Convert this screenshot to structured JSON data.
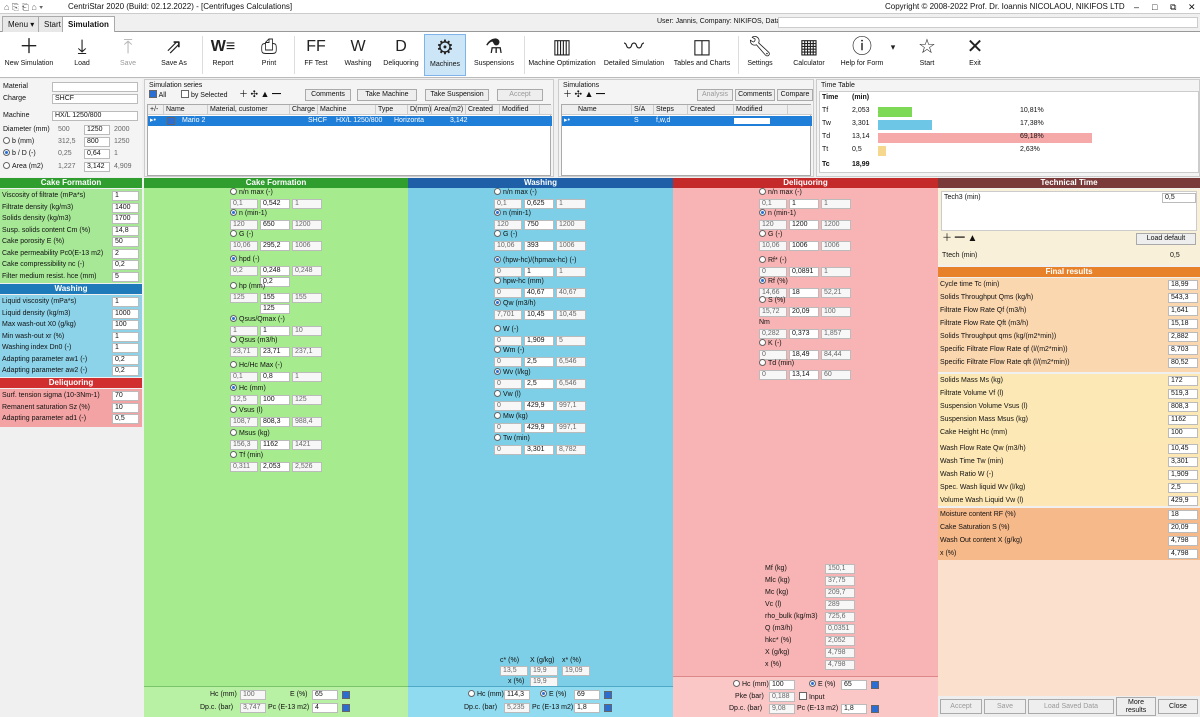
{
  "titlebar": {
    "app": "CentriStar 2020 (Build: 02.12.2022) - [Centrifuges Calculations]",
    "copyright": "Copyright © 2008-2022 Prof. Dr. Ioannis NICOLAOU, NIKIFOS LTD",
    "user": "User: Jannis, Company: NIKIFOS, Database:"
  },
  "tabs": {
    "menu": "Menu",
    "start": "Start",
    "simulation": "Simulation"
  },
  "ribbon": {
    "new": "New Simulation",
    "load": "Load",
    "save": "Save",
    "saveas": "Save As",
    "report": "Report",
    "print": "Print",
    "fftest": "FF Test",
    "washing": "Washing",
    "deliquoring": "Deliquoring",
    "machines": "Machines",
    "suspensions": "Suspensions",
    "machopt": "Machine Optimization",
    "detailed": "Detailed Simulation",
    "tables": "Tables and Charts",
    "settings": "Settings",
    "calculator": "Calculator",
    "help": "Help for Form",
    "start": "Start",
    "exit": "Exit",
    "ff_ico": "FF",
    "w_ico": "W",
    "d_ico": "D"
  },
  "left": {
    "material_lbl": "Material",
    "material": "",
    "charge_lbl": "Charge",
    "charge": "SHCF",
    "machine_lbl": "Machine",
    "machine": "HX/L 1250/800",
    "diam_lbl": "Diameter (mm)",
    "diam": [
      "500",
      "1250",
      "2000"
    ],
    "b_lbl": "b    (mm)",
    "b": [
      "312,5",
      "800",
      "1250"
    ],
    "bd_lbl": "b / D (-)",
    "bd": [
      "0,25",
      "0,64",
      "1"
    ],
    "area_lbl": "Area (m2)",
    "area": [
      "1,227",
      "3,142",
      "4,909"
    ],
    "cake_hdr": "Cake Formation",
    "cake": [
      [
        "Viscosity of filtrate (mPa*s)",
        "1"
      ],
      [
        "Filtrate density (kg/m3)",
        "1400"
      ],
      [
        "Solids density (kg/m3)",
        "1700"
      ],
      [
        "Susp. solids content Cm (%)",
        "14,8"
      ],
      [
        "Cake porosity E (%)",
        "50"
      ],
      [
        "Cake permeability  Pc0(E-13 m2)",
        "2"
      ],
      [
        "Cake compressibility nc (-)",
        "0,2"
      ],
      [
        "Filter medium resist. hce (mm)",
        "5"
      ]
    ],
    "wash_hdr": "Washing",
    "wash": [
      [
        "Liquid viscosity (mPa*s)",
        "1"
      ],
      [
        "Liquid density (kg/m3)",
        "1000"
      ],
      [
        "Max wash-out X0 (g/kg)",
        "100"
      ],
      [
        "Min wash-out xr (%)",
        "1"
      ],
      [
        "Washing index Dn0 (-)",
        "1"
      ],
      [
        "Adapting parameter aw1 (-)",
        "0,2"
      ],
      [
        "Adapting parameter aw2 (-)",
        "0,2"
      ]
    ],
    "deliq_hdr": "Deliquoring",
    "deliq": [
      [
        "Surf. tension sigma (10-3Nm-1)",
        "70"
      ],
      [
        "Remanent saturation Sz (%)",
        "10"
      ],
      [
        "Adapting parameter ad1 (-)",
        "0,5"
      ]
    ]
  },
  "series": {
    "title": "Simulation series",
    "all": "All",
    "bysel": "by Selected",
    "comments": "Comments",
    "takemachine": "Take Machine",
    "takesusp": "Take Suspension",
    "accept": "Accept",
    "cols": [
      "+/-",
      "Name",
      "Material, customer",
      "Charge",
      "Machine",
      "Type",
      "D(mm)",
      "Area(m2)",
      "Created",
      "Modified"
    ],
    "row": [
      "Mario 2",
      "",
      "SHCF",
      "HX/L 1250/800",
      "Horizonta",
      "",
      "3,142",
      "",
      ""
    ]
  },
  "sims": {
    "title": "Simulations",
    "analysis": "Analysis",
    "comments": "Comments",
    "compare": "Compare",
    "cols": [
      "Name",
      "S/A",
      "Steps",
      "Created",
      "Modified"
    ],
    "row": [
      "",
      "S",
      "f,w,d",
      "",
      ""
    ]
  },
  "timetable": {
    "title": "Time Table",
    "col1": "Time",
    "col2": "(min)",
    "rows": [
      {
        "k": "Tf",
        "v": "2,053",
        "p": "10,81%",
        "frac": 0.1081,
        "color": "#7ed957"
      },
      {
        "k": "Tw",
        "v": "3,301",
        "p": "17,38%",
        "frac": 0.1738,
        "color": "#6ec6e6"
      },
      {
        "k": "Td",
        "v": "13,14",
        "p": "69,18%",
        "frac": 0.6918,
        "color": "#f5a9a9"
      },
      {
        "k": "Tt",
        "v": "0,5",
        "p": "2,63%",
        "frac": 0.0263,
        "color": "#f5d78e"
      }
    ],
    "total_k": "Tc",
    "total_v": "18,99"
  },
  "cakecol": {
    "hdr": "Cake Formation",
    "nmax": {
      "l": "n/n max",
      "u": "(-)",
      "v": [
        "0,1",
        "0,542",
        "1"
      ]
    },
    "n": {
      "l": "n",
      "u": "(min-1)",
      "v": [
        "120",
        "650",
        "1200"
      ]
    },
    "g": {
      "l": "G",
      "u": "(-)",
      "v": [
        "10,06",
        "295,2",
        "1006"
      ]
    },
    "hpd": {
      "l": "hpd",
      "u": "(-)",
      "v": [
        "0,2",
        "0,248",
        "0,248"
      ],
      "v2": "0,2"
    },
    "hp": {
      "l": "hp",
      "u": "(mm)",
      "v": [
        "125",
        "155",
        "155"
      ],
      "v2": "125"
    },
    "qsus": {
      "l": "Qsus/Qmax",
      "u": "(-)",
      "v": [
        "1",
        "1",
        "10"
      ]
    },
    "qsus2": {
      "l": "Qsus",
      "u": "(m3/h)",
      "v": [
        "23,71",
        "23,71",
        "237,1"
      ]
    },
    "hchc": {
      "l": "Hc/Hc Max",
      "u": "(-)",
      "v": [
        "0,1",
        "0,8",
        "1"
      ]
    },
    "hc": {
      "l": "Hc",
      "u": "(mm)",
      "v": [
        "12,5",
        "100",
        "125"
      ]
    },
    "vsus": {
      "l": "Vsus",
      "u": "(l)",
      "v": [
        "108,7",
        "808,3",
        "988,4"
      ]
    },
    "msus": {
      "l": "Msus",
      "u": "(kg)",
      "v": [
        "156,3",
        "1162",
        "1421"
      ]
    },
    "tf": {
      "l": "Tf",
      "u": "(min)",
      "v": [
        "0,311",
        "2,053",
        "2,526"
      ]
    },
    "foot": {
      "hc": "Hc (mm)",
      "hcv": "100",
      "e": "E (%)",
      "ev": "65",
      "dp": "Dp.c. (bar)",
      "dpv": "3,747",
      "pc": "Pc (E-13 m2)",
      "pcv": "4"
    }
  },
  "washcol": {
    "hdr": "Washing",
    "nmax": {
      "l": "n/n max",
      "u": "(-)",
      "v": [
        "0,1",
        "0,625",
        "1"
      ]
    },
    "n": {
      "l": "n",
      "u": "(min-1)",
      "v": [
        "120",
        "750",
        "1200"
      ]
    },
    "g": {
      "l": "G",
      "u": "(-)",
      "v": [
        "10,06",
        "393",
        "1006"
      ]
    },
    "hpw": {
      "l": "(hpw-hc)/(hpmax-hc)",
      "u": "(-)",
      "v": [
        "0",
        "1",
        "1"
      ]
    },
    "hpwhc": {
      "l": "hpw-hc",
      "u": "(mm)",
      "v": [
        "0",
        "40,67",
        "40,67"
      ]
    },
    "qw": {
      "l": "Qw",
      "u": "(m3/h)",
      "v": [
        "7,701",
        "10,45",
        "10,45"
      ]
    },
    "w": {
      "l": "W",
      "u": "(-)",
      "v": [
        "0",
        "1,909",
        "5"
      ]
    },
    "wm": {
      "l": "Wm",
      "u": "(-)",
      "v": [
        "0",
        "2,5",
        "6,546"
      ]
    },
    "wv": {
      "l": "Wv",
      "u": "(l/kg)",
      "v": [
        "0",
        "2,5",
        "6,546"
      ]
    },
    "vw": {
      "l": "Vw",
      "u": "(l)",
      "v": [
        "0",
        "429,9",
        "997,1"
      ]
    },
    "mw": {
      "l": "Mw",
      "u": "(kg)",
      "v": [
        "0",
        "429,9",
        "997,1"
      ]
    },
    "tw": {
      "l": "Tw",
      "u": "(min)",
      "v": [
        "0",
        "3,301",
        "8,782"
      ]
    },
    "c": {
      "h": [
        "c* (%)",
        "X (g/kg)",
        "x* (%)"
      ],
      "v": [
        "13,5",
        "19,9",
        "19,09"
      ],
      "xl": "x (%)",
      "xv": "19,9"
    },
    "foot": {
      "hc": "Hc (mm)",
      "hcv": "114,3",
      "e": "E (%)",
      "ev": "69",
      "dp": "Dp.c. (bar)",
      "dpv": "5,235",
      "pc": "Pc (E-13 m2)",
      "pcv": "1,8"
    }
  },
  "deliqcol": {
    "hdr": "Deliquoring",
    "nmax": {
      "l": "n/n max",
      "u": "(-)",
      "v": [
        "0,1",
        "1",
        "1"
      ]
    },
    "n": {
      "l": "n",
      "u": "(min-1)",
      "v": [
        "120",
        "1200",
        "1200"
      ]
    },
    "g": {
      "l": "G",
      "u": "(-)",
      "v": [
        "10,06",
        "1006",
        "1006"
      ]
    },
    "rf1": {
      "l": "Rf*",
      "u": "(-)",
      "v": [
        "0",
        "0,0891",
        "1"
      ]
    },
    "rf": {
      "l": "Rf",
      "u": "(%)",
      "v": [
        "14,66",
        "18",
        "52,21"
      ]
    },
    "s": {
      "l": "S",
      "u": "(%)",
      "v": [
        "15,72",
        "20,09",
        "100"
      ]
    },
    "nm": {
      "l": "Nm",
      "u": "",
      "v": [
        "0,282",
        "0,373",
        "1,857"
      ]
    },
    "k": {
      "l": "K",
      "u": "(-)",
      "v": [
        "0",
        "18,49",
        "84,44"
      ]
    },
    "td": {
      "l": "Td",
      "u": "(min)",
      "v": [
        "0",
        "13,14",
        "60"
      ]
    },
    "list": [
      [
        "Mf (kg)",
        "150,1"
      ],
      [
        "Mlc (kg)",
        "37,75"
      ],
      [
        "Mc (kg)",
        "209,7"
      ],
      [
        "Vc (l)",
        "289"
      ],
      [
        "rho_bulk (kg/m3)",
        "725,6"
      ],
      [
        "Q (m3/h)",
        "0,0351"
      ],
      [
        "hkc* (%)",
        "2,052"
      ],
      [
        "X (g/kg)",
        "4,798"
      ],
      [
        "x (%)",
        "4,798"
      ]
    ],
    "foot": {
      "hc": "Hc (mm)",
      "hcv": "100",
      "e": "E (%)",
      "ev": "65",
      "pke": "Pke (bar)",
      "pkev": "0,188",
      "input": "Input",
      "dp": "Dp.c. (bar)",
      "dpv": "9,08",
      "pc": "Pc (E-13 m2)",
      "pcv": "1,8"
    }
  },
  "tech": {
    "hdr": "Technical Time",
    "name": "Tech3 (min)",
    "val": "0,5",
    "loaddef": "Load default",
    "ttech": "Ttech (min)",
    "ttechv": "0,5"
  },
  "final": {
    "hdr": "Final results",
    "g1": [
      [
        "Cycle time Tc (min)",
        "18,99"
      ],
      [
        "Solids Throughput Qms (kg/h)",
        "543,3"
      ],
      [
        "Filtrate Flow Rate Qf (m3/h)",
        "1,641"
      ],
      [
        "Filtrate Flow Rate Qft (m3/h)",
        "15,18"
      ],
      [
        "Solids Throughput qms (kg/(m2*min))",
        "2,882"
      ],
      [
        "Specific Filtrate Flow Rate qf (l/(m2*min))",
        "8,703"
      ],
      [
        "Specific Filtrate Flow Rate qft (l/(m2*min))",
        "80,52"
      ]
    ],
    "g2": [
      [
        "Solids Mass Ms (kg)",
        "172"
      ],
      [
        "Filtrate Volume Vf (l)",
        "519,3"
      ],
      [
        "Suspension Volume Vsus (l)",
        "808,3"
      ],
      [
        "Suspension Mass Msus (kg)",
        "1162"
      ],
      [
        "Cake Height Hc (mm)",
        "100"
      ]
    ],
    "g3": [
      [
        "Wash Flow Rate Qw (m3/h)",
        "10,45"
      ],
      [
        "Wash Time Tw (min)",
        "3,301"
      ],
      [
        "Wash Ratio W (-)",
        "1,909"
      ],
      [
        "Spec. Wash liquid Wv (l/kg)",
        "2,5"
      ],
      [
        "Volume Wash Liquid Vw (l)",
        "429,9"
      ]
    ],
    "g4": [
      [
        "Moisture content RF (%)",
        "18"
      ],
      [
        "Cake Saturation S (%)",
        "20,09"
      ],
      [
        "Wash Out content X (g/kg)",
        "4,798"
      ],
      [
        "x (%)",
        "4,798"
      ]
    ],
    "btns": {
      "accept": "Accept",
      "save": "Save",
      "loadsaved": "Load Saved Data",
      "more": "More results",
      "close": "Close"
    }
  }
}
